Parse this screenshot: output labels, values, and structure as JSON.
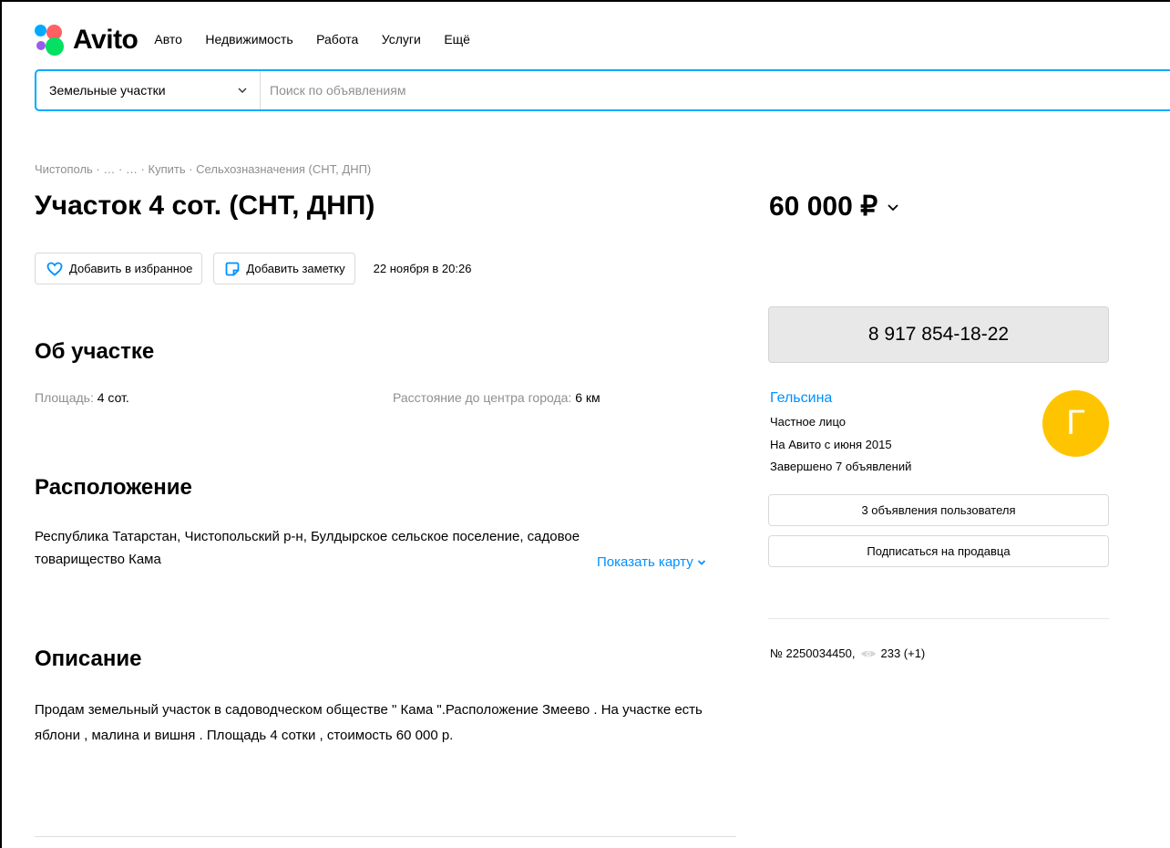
{
  "header": {
    "logo_text": "Avito",
    "nav": [
      "Авто",
      "Недвижимость",
      "Работа",
      "Услуги",
      "Ещё"
    ]
  },
  "search": {
    "category": "Земельные участки",
    "placeholder": "Поиск по объявлениям"
  },
  "breadcrumb": [
    "Чистополь",
    "…",
    "…",
    "Купить",
    "Сельхозназначения (СНТ, ДНП)"
  ],
  "listing": {
    "title": "Участок 4 сот. (СНТ, ДНП)",
    "price": "60 000 ₽",
    "favorite_label": "Добавить в избранное",
    "note_label": "Добавить заметку",
    "date": "22 ноября в 20:26"
  },
  "about": {
    "heading": "Об участке",
    "area_label": "Площадь:",
    "area_value": "4 сот.",
    "distance_label": "Расстояние до центра города:",
    "distance_value": "6 км"
  },
  "location": {
    "heading": "Расположение",
    "address": "Республика Татарстан, Чистопольский р-н, Булдырское сельское поселение, садовое товарищество Кама",
    "show_map": "Показать карту"
  },
  "description": {
    "heading": "Описание",
    "text": "Продам земельный участок в садоводческом обществе \" Кама \".Расположение Змеево . На участке есть яблони , малина и вишня . Площадь 4 сотки , стоимость 60 000 р."
  },
  "seller": {
    "phone": "8 917 854-18-22",
    "name": "Гельсина",
    "type": "Частное лицо",
    "since": "На Авито с июня 2015",
    "completed": "Завершено 7 объявлений",
    "avatar_letter": "Г",
    "listings_button": "3 объявления пользователя",
    "subscribe_button": "Подписаться на продавца"
  },
  "meta": {
    "ad_number": "№ 2250034450,",
    "views": "233 (+1)"
  },
  "colors": {
    "accent": "#00aaff",
    "link": "#0091ff",
    "avatar": "#ffc400"
  }
}
